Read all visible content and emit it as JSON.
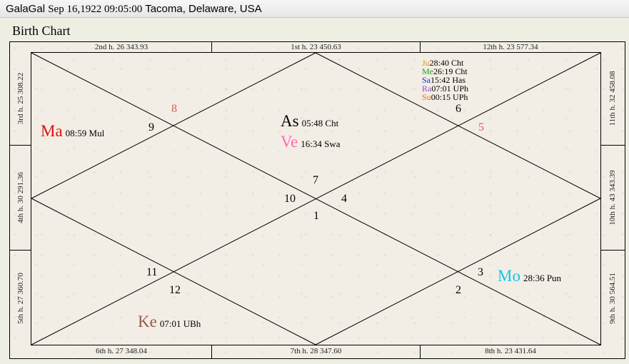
{
  "title_bar": {
    "name": "GalaGal",
    "datetime": "Sep 16,1922 09:05:00",
    "place": "Tacoma, Delaware, USA"
  },
  "chart_title": "Birth Chart",
  "houses": {
    "top": [
      "2nd h.  26  343.93",
      "1st h.  23  450.63",
      "12th h.  23  577.34"
    ],
    "bottom": [
      "6th h.  27  348.04",
      "7th h.  28  347.60",
      "8th h.  23  431.64"
    ],
    "left": [
      "3rd h.  25  308.22",
      "4th h.  30  291.36",
      "5th h.  27  360.70"
    ],
    "right": [
      "11th h.  32  458.08",
      "10th h.  43  343.39",
      "9th h.  30  564.51"
    ]
  },
  "sign_numbers": {
    "n7": "7",
    "n10": "10",
    "n4": "4",
    "n1": "1",
    "n8": "8",
    "n9": "9",
    "n6": "6",
    "n5": "5",
    "n11": "11",
    "n12": "12",
    "n3": "3",
    "n2": "2"
  },
  "planets": {
    "as": {
      "name": "As",
      "deg": "05:48 Cht",
      "color": "#000000"
    },
    "ve": {
      "name": "Ve",
      "deg": "16:34 Swa",
      "color": "#ff69b4"
    },
    "ma": {
      "name": "Ma",
      "deg": "08:59 Mul",
      "color": "#e01010"
    },
    "mo": {
      "name": "Mo",
      "deg": "28:36 Pun",
      "color": "#10c8e8"
    },
    "ke": {
      "name": "Ke",
      "deg": "07:01 UBh",
      "color": "#9a5a4a"
    }
  },
  "house12_list": [
    {
      "name": "Ju",
      "deg": "28:40 Cht",
      "color": "#e09020"
    },
    {
      "name": "Me",
      "deg": "26:19 Cht",
      "color": "#18a018"
    },
    {
      "name": "Sa",
      "deg": "15:42 Has",
      "color": "#1030d0"
    },
    {
      "name": "Ra",
      "deg": "07:01 UPh",
      "color": "#8a50c0"
    },
    {
      "name": "Su",
      "deg": "00:15 UPh",
      "color": "#e07010"
    }
  ]
}
